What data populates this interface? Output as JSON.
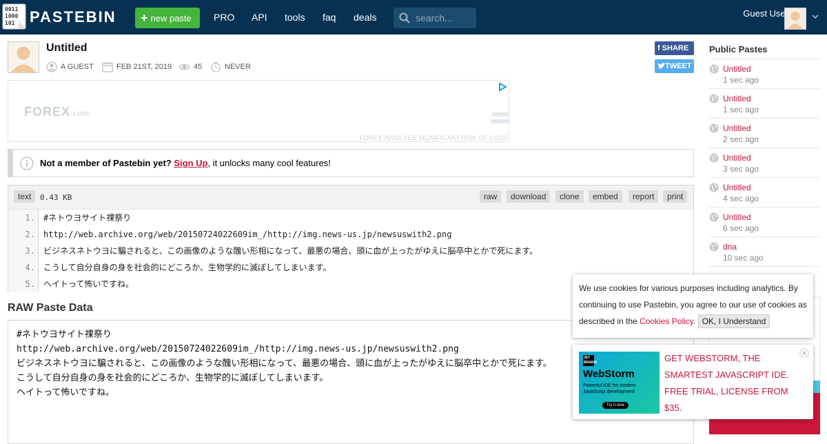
{
  "header": {
    "logo_text": "0011 1000 101",
    "brand": "PASTEBIN",
    "new_paste_label": "new paste",
    "nav": [
      {
        "label": "PRO"
      },
      {
        "label": "API"
      },
      {
        "label": "tools"
      },
      {
        "label": "faq"
      },
      {
        "label": "deals"
      }
    ],
    "search_placeholder": "search...",
    "user_name": "Guest User",
    "user_sub": "-"
  },
  "paste": {
    "title": "Untitled",
    "author": "A GUEST",
    "date": "FEB 21ST, 2019",
    "views": "45",
    "expires": "NEVER",
    "share_label": "SHARE",
    "tweet_label": "TWEET"
  },
  "ad": {
    "brand_main": "FOREX",
    "brand_suffix": ".com",
    "risk_text": "FOREX INVOLVES SIGNIFICANT RISK OF LOSS"
  },
  "notice": {
    "lead": "Not a member of Pastebin yet?",
    "link": "Sign Up",
    "rest": ", it unlocks many cool features!"
  },
  "code": {
    "syntax": "text",
    "size": "0.43 KB",
    "actions": [
      {
        "label": "raw"
      },
      {
        "label": "download"
      },
      {
        "label": "clone"
      },
      {
        "label": "embed"
      },
      {
        "label": "report"
      },
      {
        "label": "print"
      }
    ],
    "lines": [
      {
        "num": "1.",
        "text": "#ネトウヨサイト祼祭り"
      },
      {
        "num": "2.",
        "text": "http://web.archive.org/web/20150724022609im_/http://img.news-us.jp/newsuswith2.png"
      },
      {
        "num": "3.",
        "text": "ビジネスネトウヨに騙されると、この画像のような醜い形相になって、最悪の場合、頭に血が上ったがゆえに脳卒中とかで死にます。"
      },
      {
        "num": "4.",
        "text": "こうして自分自身の身を社会的にどころか、生物学的に滅ぼしてしまいます。"
      },
      {
        "num": "5.",
        "text": "ヘイトって怖いですね。"
      }
    ]
  },
  "raw": {
    "title": "RAW Paste Data",
    "lines": [
      "#ネトウヨサイト祼祭り",
      "http://web.archive.org/web/20150724022609im_/http://img.news-us.jp/newsuswith2.png",
      "ビジネスネトウヨに騙されると、この画像のような醜い形相になって、最悪の場合、頭に血が上ったがゆえに脳卒中とかで死にます。",
      "こうして自分自身の身を社会的にどころか、生物学的に滅ぼしてしまいます。",
      "ヘイトって怖いですね。"
    ]
  },
  "sidebar": {
    "title": "Public Pastes",
    "items": [
      {
        "name": "Untitled",
        "ago": "1 sec ago"
      },
      {
        "name": "Untitled",
        "ago": "1 sec ago"
      },
      {
        "name": "Untitled",
        "ago": "2 sec ago"
      },
      {
        "name": "Untitled",
        "ago": "3 sec ago"
      },
      {
        "name": "Untitled",
        "ago": "4 sec ago"
      },
      {
        "name": "Untitled",
        "ago": "6 sec ago"
      },
      {
        "name": "dna",
        "ago": "10 sec ago"
      }
    ]
  },
  "cookie": {
    "text": "We use cookies for various purposes including analytics. By continuing to use Pastebin, you agree to our use of cookies as described in the",
    "link": "Cookies Policy",
    "button": "OK, I Understand"
  },
  "webstorm": {
    "jb": "JET BRAINS",
    "name": "WebStorm",
    "sub": "Powerful IDE for modern JavaScript development",
    "try": "Try it now",
    "text": "GET WEBSTORM, THE SMARTEST JAVASCRIPT IDE. FREE TRIAL, LICENSE FROM $35."
  },
  "colors": {
    "header_bg": "#073152",
    "accent_green": "#44b43c",
    "link_red": "#c4173c",
    "facebook": "#3b5998",
    "twitter": "#55acee"
  },
  "icons": [
    "search-icon",
    "user-icon",
    "calendar-icon",
    "eye-icon",
    "clock-icon",
    "info-icon",
    "globe-icon",
    "close-icon",
    "chevron-down-icon",
    "adchoices-icon"
  ]
}
